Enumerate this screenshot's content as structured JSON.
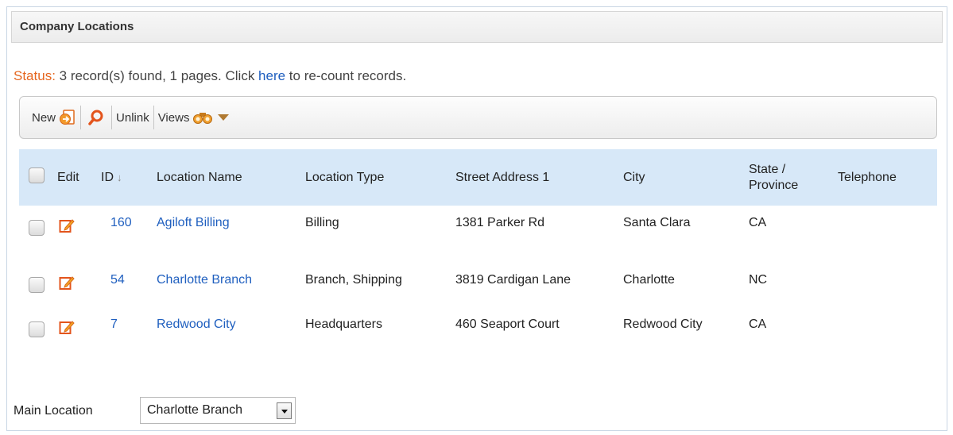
{
  "section": {
    "title": "Company Locations"
  },
  "status": {
    "label": "Status:",
    "text_before": " 3 record(s) found, 1 pages. Click ",
    "link": "here",
    "text_after": " to re-count records."
  },
  "toolbar": {
    "new_label": "New",
    "unlink_label": "Unlink",
    "views_label": "Views"
  },
  "table": {
    "headers": {
      "edit": "Edit",
      "id": "ID",
      "sort_indicator": "↓",
      "location_name": "Location Name",
      "location_type": "Location Type",
      "street": "Street Address 1",
      "city": "City",
      "state_line1": "State /",
      "state_line2": "Province",
      "telephone": "Telephone"
    },
    "rows": [
      {
        "id": "160",
        "name": "Agiloft Billing",
        "type": "Billing",
        "street": "1381 Parker Rd",
        "city": "Santa Clara",
        "state": "CA",
        "telephone": ""
      },
      {
        "id": "54",
        "name": "Charlotte Branch",
        "type": "Branch, Shipping",
        "street": "3819 Cardigan Lane",
        "city": "Charlotte",
        "state": "NC",
        "telephone": ""
      },
      {
        "id": "7",
        "name": "Redwood City",
        "type": "Headquarters",
        "street": "460 Seaport Court",
        "city": "Redwood City",
        "state": "CA",
        "telephone": ""
      }
    ]
  },
  "main_location": {
    "label": "Main Location",
    "selected": "Charlotte Branch"
  },
  "colors": {
    "status_label": "#e5661f",
    "link": "#1f5fbf",
    "header_bg": "#d7e8f8",
    "row_band": "#f3f3f3"
  },
  "icons": {
    "new": "new-record-icon",
    "search": "search-icon",
    "views": "binocular-icon",
    "views_menu": "caret-down-icon",
    "edit": "edit-pencil-icon"
  }
}
